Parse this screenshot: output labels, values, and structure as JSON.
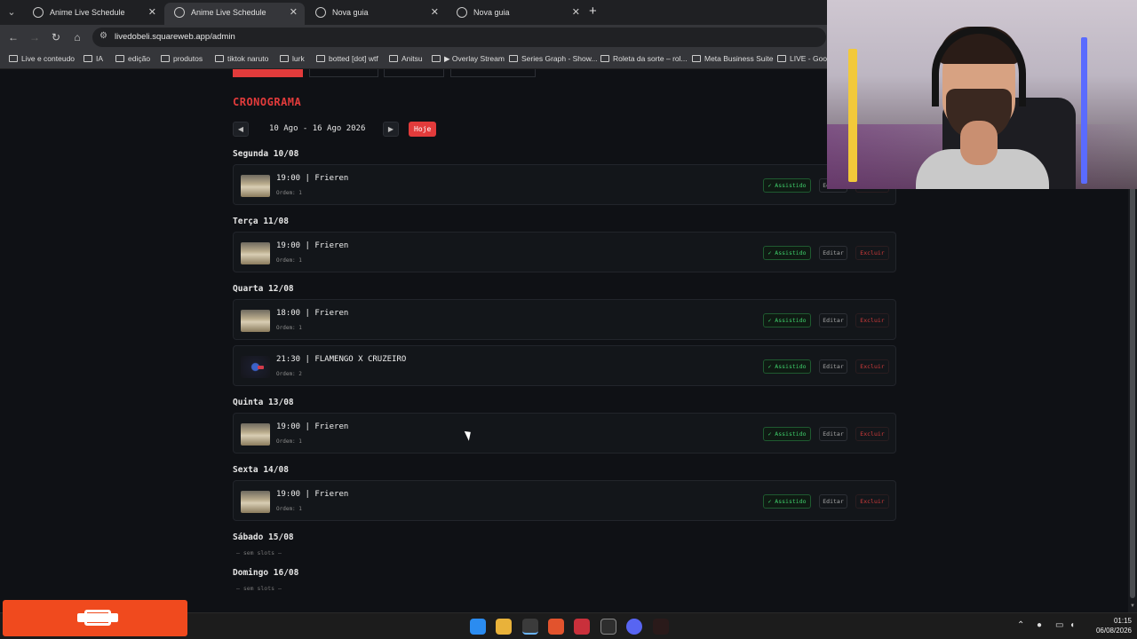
{
  "browser": {
    "tabs": [
      {
        "title": "Anime Live Schedule",
        "active": false
      },
      {
        "title": "Anime Live Schedule",
        "active": true
      },
      {
        "title": "Nova guia",
        "active": false
      },
      {
        "title": "Nova guia",
        "active": false
      }
    ],
    "url": "livedobeli.squareweb.app/admin",
    "bookmarks": [
      "Live e conteudo",
      "IA",
      "edição",
      "produtos",
      "tiktok naruto",
      "lurk",
      "botted [dot] wtf",
      "Anitsu",
      "▶ Overlay Stream",
      "Series Graph - Show...",
      "Roleta da sorte – rol...",
      "Meta Business Suite",
      "LIVE - Goog"
    ]
  },
  "schedule": {
    "title": "CRONOGRAMA",
    "week_range": "10 Ago - 16 Ago 2026",
    "today_label": "Hoje",
    "prev_icon": "◀",
    "next_icon": "▶",
    "watched_label": "✓ Assistido",
    "edit_label": "Editar",
    "delete_label": "Excluir",
    "no_slots_label": "— sem slots —",
    "days": [
      {
        "label": "Segunda 10/08",
        "slots": [
          {
            "title": "19:00 | Frieren",
            "order": "Ordem: 1",
            "thumb": "frieren"
          }
        ]
      },
      {
        "label": "Terça 11/08",
        "slots": [
          {
            "title": "19:00 | Frieren",
            "order": "Ordem: 1",
            "thumb": "frieren"
          }
        ]
      },
      {
        "label": "Quarta 12/08",
        "slots": [
          {
            "title": "18:00 | Frieren",
            "order": "Ordem: 1",
            "thumb": "frieren"
          },
          {
            "title": "21:30 | FLAMENGO X CRUZEIRO",
            "order": "Ordem: 2",
            "thumb": "logo"
          }
        ]
      },
      {
        "label": "Quinta 13/08",
        "slots": [
          {
            "title": "19:00 | Frieren",
            "order": "Ordem: 1",
            "thumb": "frieren"
          }
        ]
      },
      {
        "label": "Sexta 14/08",
        "slots": [
          {
            "title": "19:00 | Frieren",
            "order": "Ordem: 1",
            "thumb": "frieren"
          }
        ]
      },
      {
        "label": "Sábado 15/08",
        "slots": []
      },
      {
        "label": "Domingo 16/08",
        "slots": []
      }
    ]
  },
  "taskbar": {
    "time": "01:15",
    "date": "06/08/2026"
  },
  "colors": {
    "accent": "#e23b3b",
    "watched": "#3fcf6b",
    "background": "#0f1115"
  }
}
